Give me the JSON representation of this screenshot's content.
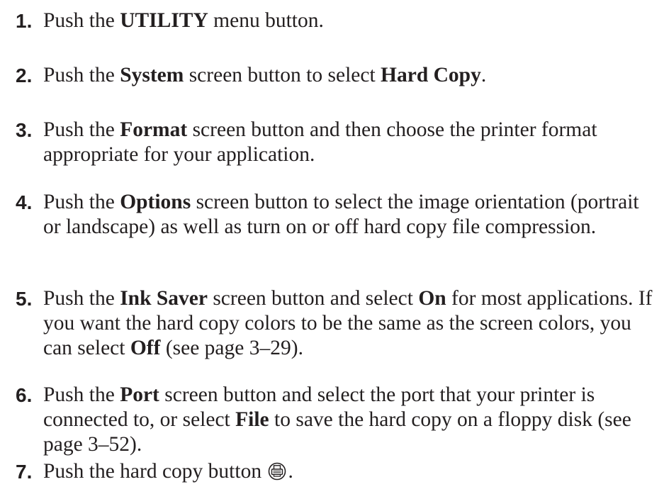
{
  "steps": [
    {
      "num": "1.",
      "parts": [
        "Push the ",
        "UTILITY",
        " menu button."
      ]
    },
    {
      "num": "2.",
      "parts": [
        "Push the ",
        "System",
        " screen button to select ",
        "Hard Copy",
        "."
      ]
    },
    {
      "num": "3.",
      "parts": [
        "Push the ",
        "Format",
        " screen button and then choose the printer format appropriate for your application."
      ]
    },
    {
      "num": "4.",
      "parts": [
        "Push the ",
        "Options",
        " screen button to select the image orientation (portrait or landscape) as well as turn on or off hard copy file compression."
      ]
    },
    {
      "num": "5.",
      "parts": [
        "Push the ",
        "Ink Saver",
        " screen button and select ",
        "On",
        " for most applications. If you want the hard copy colors to be the same as the screen colors, you can select ",
        "Off",
        " (see page 3–29)."
      ]
    },
    {
      "num": "6.",
      "parts": [
        "Push the ",
        "Port",
        " screen button and select the port that your printer is connected to, or select ",
        "File",
        " to save the hard copy on a floppy disk (see page 3–52)."
      ]
    },
    {
      "num": "7.",
      "parts": [
        "Push the hard copy button ",
        "."
      ],
      "icon": "printer-hardcopy-icon"
    }
  ]
}
